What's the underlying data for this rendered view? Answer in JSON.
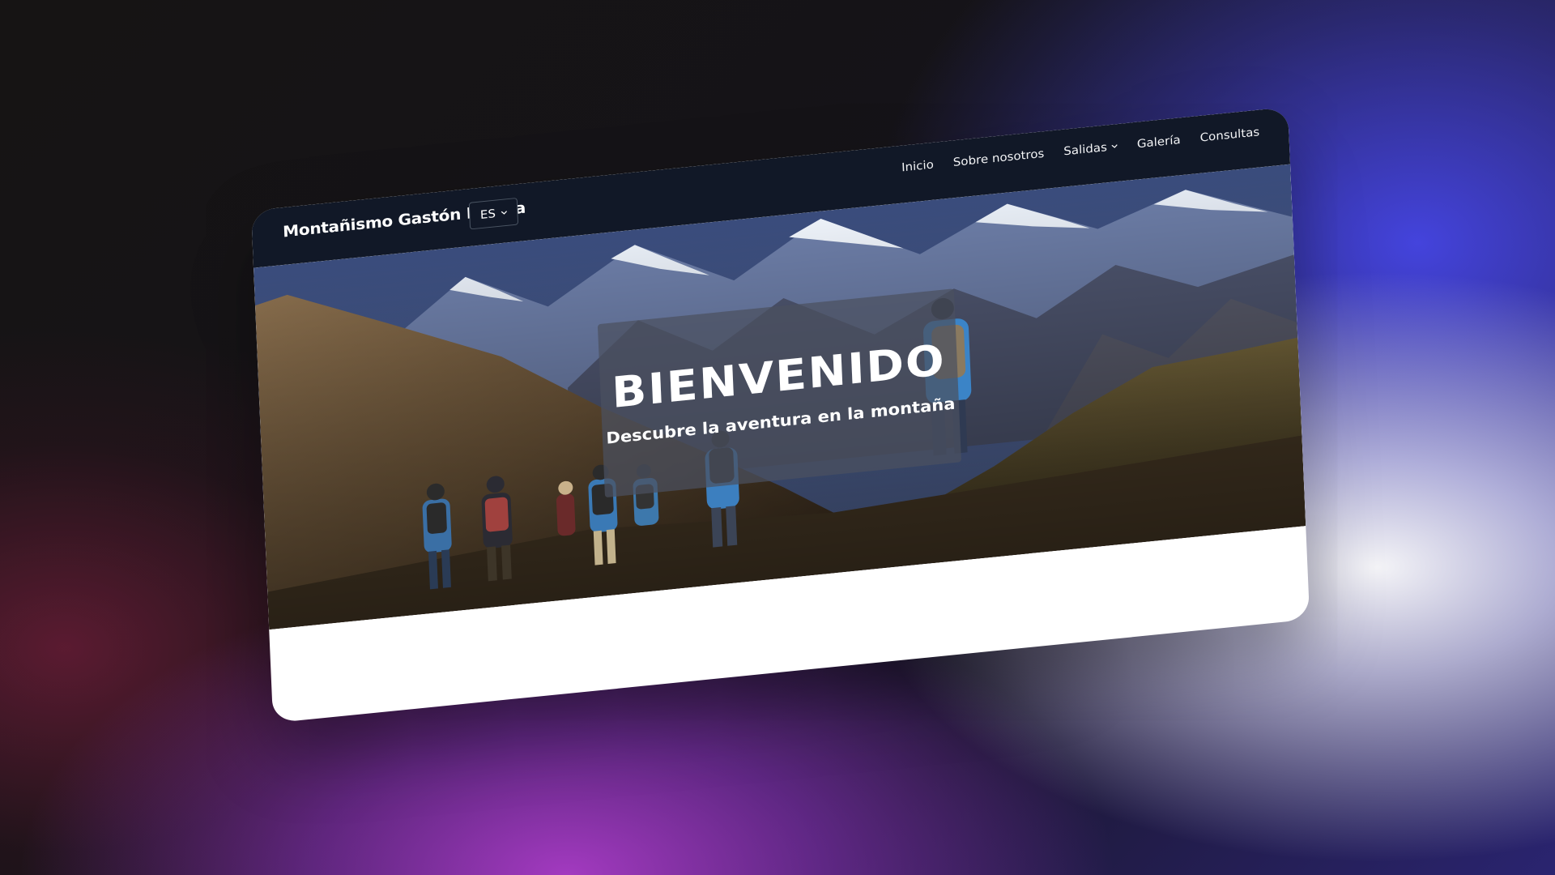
{
  "site": {
    "brand": "Montañismo Gastón Molina",
    "language": {
      "selected": "ES",
      "icon": "chevron-down-icon"
    }
  },
  "nav": {
    "items": [
      {
        "label": "Inicio"
      },
      {
        "label": "Sobre nosotros"
      },
      {
        "label": "Salidas",
        "icon": "chevron-down-icon"
      },
      {
        "label": "Galería"
      },
      {
        "label": "Consultas"
      }
    ]
  },
  "hero": {
    "title": "BIENVENIDO",
    "subtitle": "Descubre la aventura en la montaña"
  },
  "colors": {
    "navbar_bg": "#111827",
    "card_bg": "rgba(75,80,95,0.72)",
    "text": "#ffffff"
  }
}
